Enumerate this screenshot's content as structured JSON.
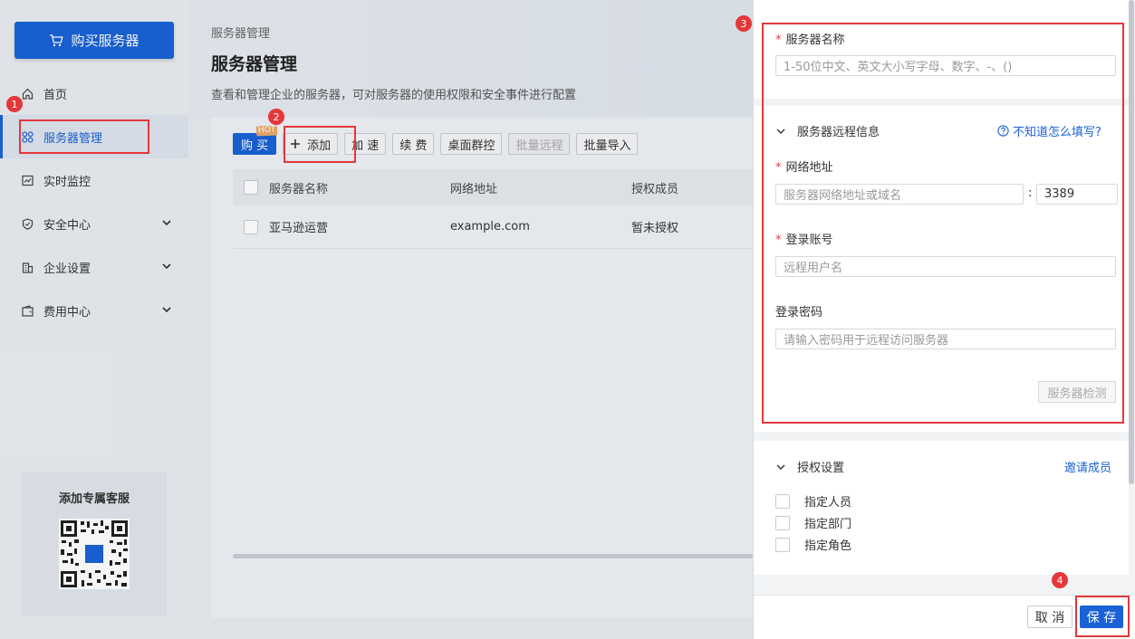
{
  "sidebar": {
    "buy_label": "购买服务器",
    "items": [
      {
        "label": "首页",
        "icon": "home-icon"
      },
      {
        "label": "服务器管理",
        "icon": "grid-icon",
        "active": true
      },
      {
        "label": "实时监控",
        "icon": "chart-icon"
      },
      {
        "label": "安全中心",
        "icon": "shield-icon",
        "expandable": true
      },
      {
        "label": "企业设置",
        "icon": "building-icon",
        "expandable": true
      },
      {
        "label": "费用中心",
        "icon": "wallet-icon",
        "expandable": true
      }
    ],
    "service_title": "添加专属客服"
  },
  "header": {
    "breadcrumb": "服务器管理",
    "title": "服务器管理",
    "description": "查看和管理企业的服务器，可对服务器的使用权限和安全事件进行配置"
  },
  "toolbar": {
    "buy": "购 买",
    "hot": "HOT",
    "add": "添加",
    "speed": "加 速",
    "renew": "续 费",
    "desktop": "桌面群控",
    "batch_remote": "批量远程",
    "batch_import": "批量导入"
  },
  "table": {
    "headers": [
      "服务器名称",
      "网络地址",
      "授权成员"
    ],
    "rows": [
      {
        "name": "亚马逊运营",
        "address": "example.com",
        "members": "暂未授权"
      }
    ]
  },
  "drawer": {
    "server_name_label": "服务器名称",
    "server_name_placeholder": "1-50位中文、英文大小写字母、数字、-、()",
    "remote_section": "服务器远程信息",
    "help_link": "不知道怎么填写?",
    "address_label": "网络地址",
    "address_placeholder": "服务器网络地址或域名",
    "port_sep": ":",
    "port_value": "3389",
    "account_label": "登录账号",
    "account_placeholder": "远程用户名",
    "password_label": "登录密码",
    "password_placeholder": "请输入密码用于远程访问服务器",
    "check_button": "服务器检测",
    "auth_section": "授权设置",
    "invite_link": "邀请成员",
    "auth_options": [
      "指定人员",
      "指定部门",
      "指定角色"
    ],
    "cancel": "取 消",
    "save": "保 存"
  },
  "annotations": [
    "1",
    "2",
    "3",
    "4"
  ],
  "colors": {
    "accent": "#1a62d6",
    "annotation": "#e3383b",
    "required": "#e23b3b"
  }
}
